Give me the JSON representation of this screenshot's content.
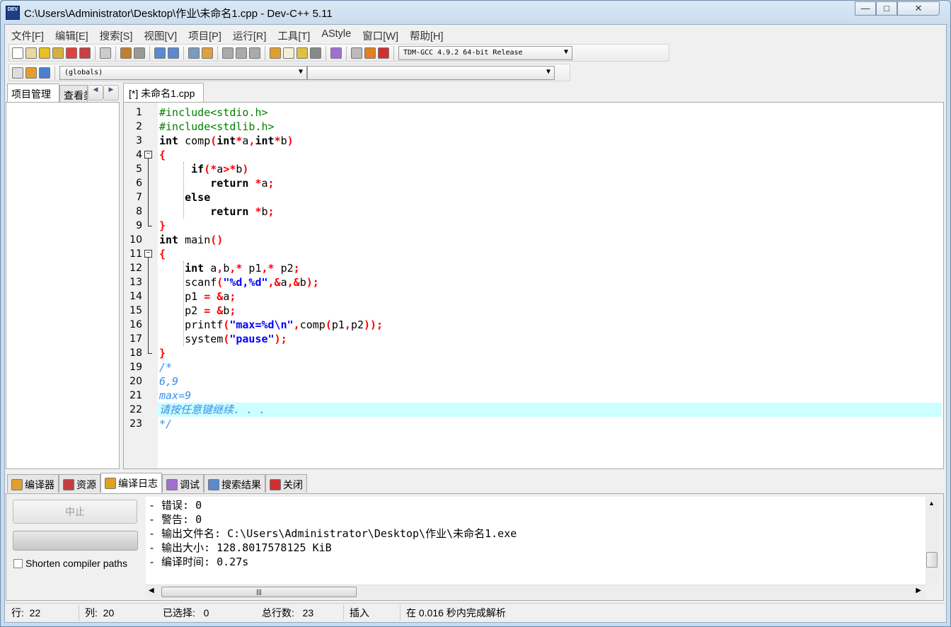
{
  "window": {
    "title": "C:\\Users\\Administrator\\Desktop\\作业\\未命名1.cpp - Dev-C++ 5.11",
    "icon_text": "DEV"
  },
  "menu": [
    "文件[F]",
    "编辑[E]",
    "搜索[S]",
    "视图[V]",
    "项目[P]",
    "运行[R]",
    "工具[T]",
    "AStyle",
    "窗口[W]",
    "帮助[H]"
  ],
  "toolbar": {
    "icons": [
      "new-file",
      "open-file",
      "save",
      "save-all",
      "close-file",
      "close-all",
      "print",
      "undo",
      "redo",
      "find",
      "replace",
      "goto-line",
      "indent",
      "unindent-disabled",
      "unindent2-disabled",
      "toggle-comment-disabled",
      "compile",
      "run",
      "compile-run",
      "rebuild-all",
      "syntax-check",
      "stop-disabled",
      "profile",
      "delete-profile"
    ],
    "compiler": "TDM-GCC 4.9.2 64-bit Release"
  },
  "toolbar2": {
    "scope": "(globals)",
    "function": ""
  },
  "left_panel": {
    "tabs": [
      "项目管理",
      "查看类"
    ]
  },
  "editor": {
    "tab": "[*] 未命名1.cpp",
    "highlight_line": 22,
    "lines": [
      [
        [
          "pp",
          "#include<stdio.h>"
        ]
      ],
      [
        [
          "pp",
          "#include<stdlib.h>"
        ]
      ],
      [
        [
          "kw",
          "int"
        ],
        [
          "id",
          " comp"
        ],
        [
          "sym",
          "("
        ],
        [
          "kw",
          "int"
        ],
        [
          "sym",
          "*"
        ],
        [
          "id",
          "a"
        ],
        [
          "sym",
          ","
        ],
        [
          "kw",
          "int"
        ],
        [
          "sym",
          "*"
        ],
        [
          "id",
          "b"
        ],
        [
          "sym",
          ")"
        ]
      ],
      [
        [
          "sym",
          "{"
        ]
      ],
      [
        [
          "id",
          "     "
        ],
        [
          "kw",
          "if"
        ],
        [
          "sym",
          "(*"
        ],
        [
          "id",
          "a"
        ],
        [
          "sym",
          ">*"
        ],
        [
          "id",
          "b"
        ],
        [
          "sym",
          ")"
        ]
      ],
      [
        [
          "id",
          "        "
        ],
        [
          "kw",
          "return"
        ],
        [
          "id",
          " "
        ],
        [
          "sym",
          "*"
        ],
        [
          "id",
          "a"
        ],
        [
          "sym",
          ";"
        ]
      ],
      [
        [
          "id",
          "    "
        ],
        [
          "kw",
          "else"
        ]
      ],
      [
        [
          "id",
          "        "
        ],
        [
          "kw",
          "return"
        ],
        [
          "id",
          " "
        ],
        [
          "sym",
          "*"
        ],
        [
          "id",
          "b"
        ],
        [
          "sym",
          ";"
        ]
      ],
      [
        [
          "sym",
          "}"
        ]
      ],
      [
        [
          "kw",
          "int"
        ],
        [
          "id",
          " main"
        ],
        [
          "sym",
          "()"
        ]
      ],
      [
        [
          "sym",
          "{"
        ]
      ],
      [
        [
          "id",
          "    "
        ],
        [
          "kw",
          "int"
        ],
        [
          "id",
          " a"
        ],
        [
          "sym",
          ","
        ],
        [
          "id",
          "b"
        ],
        [
          "sym",
          ",*"
        ],
        [
          "id",
          " p1"
        ],
        [
          "sym",
          ",*"
        ],
        [
          "id",
          " p2"
        ],
        [
          "sym",
          ";"
        ]
      ],
      [
        [
          "id",
          "    scanf"
        ],
        [
          "sym",
          "("
        ],
        [
          "str",
          "\"%d,%d\""
        ],
        [
          "sym",
          ",&"
        ],
        [
          "id",
          "a"
        ],
        [
          "sym",
          ",&"
        ],
        [
          "id",
          "b"
        ],
        [
          "sym",
          ");"
        ]
      ],
      [
        [
          "id",
          "    p1 "
        ],
        [
          "sym",
          "= &"
        ],
        [
          "id",
          "a"
        ],
        [
          "sym",
          ";"
        ]
      ],
      [
        [
          "id",
          "    p2 "
        ],
        [
          "sym",
          "= &"
        ],
        [
          "id",
          "b"
        ],
        [
          "sym",
          ";"
        ]
      ],
      [
        [
          "id",
          "    printf"
        ],
        [
          "sym",
          "("
        ],
        [
          "str",
          "\"max=%d\\n\""
        ],
        [
          "sym",
          ","
        ],
        [
          "id",
          "comp"
        ],
        [
          "sym",
          "("
        ],
        [
          "id",
          "p1"
        ],
        [
          "sym",
          ","
        ],
        [
          "id",
          "p2"
        ],
        [
          "sym",
          "));"
        ]
      ],
      [
        [
          "id",
          "    system"
        ],
        [
          "sym",
          "("
        ],
        [
          "str",
          "\"pause\""
        ],
        [
          "sym",
          ");"
        ]
      ],
      [
        [
          "sym",
          "}"
        ]
      ],
      [
        [
          "cm",
          "/*"
        ]
      ],
      [
        [
          "cm",
          "6,9"
        ]
      ],
      [
        [
          "cm",
          "max=9"
        ]
      ],
      [
        [
          "cm",
          "请按任意键继续. . ."
        ]
      ],
      [
        [
          "cm",
          "*/"
        ]
      ]
    ]
  },
  "bottom": {
    "tabs": [
      "编译器",
      "资源",
      "编译日志",
      "调试",
      "搜索结果",
      "关闭"
    ],
    "active_tab": "编译日志",
    "abort_button": "中止",
    "shorten_label": "Shorten compiler paths",
    "shorten_checked": false,
    "log": [
      "- 错误: 0",
      "- 警告: 0",
      "- 输出文件名: C:\\Users\\Administrator\\Desktop\\作业\\未命名1.exe",
      "- 输出大小: 128.8017578125 KiB",
      "- 编译时间: 0.27s"
    ]
  },
  "status": {
    "line_label": "行:",
    "line": "22",
    "col_label": "列:",
    "col": "20",
    "sel_label": "已选择:",
    "sel": "0",
    "total_label": "总行数:",
    "total": "23",
    "mode": "插入",
    "parse": "在 0.016 秒内完成解析"
  }
}
